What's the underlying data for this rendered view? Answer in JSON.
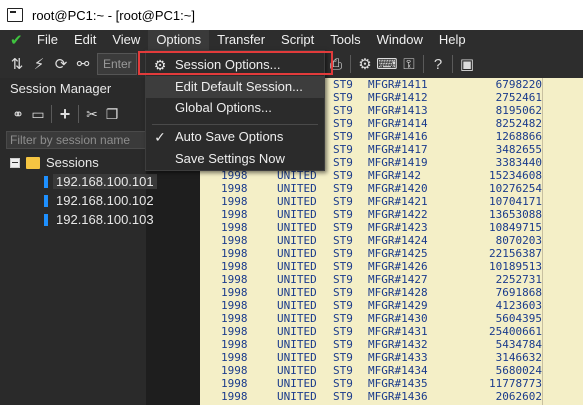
{
  "window": {
    "title": "root@PC1:~ - [root@PC1:~]"
  },
  "menubar": {
    "items": [
      "File",
      "Edit",
      "View",
      "Options",
      "Transfer",
      "Script",
      "Tools",
      "Window",
      "Help"
    ]
  },
  "toolbar": {
    "input_placeholder": "Enter"
  },
  "session_manager": {
    "title": "Session Manager",
    "filter_placeholder": "Filter by session name",
    "root": "Sessions",
    "hosts": [
      "192.168.100.101",
      "192.168.100.102",
      "192.168.100.103"
    ]
  },
  "options_menu": {
    "items": [
      {
        "label": "Session Options...",
        "icon": "gear-icon"
      },
      {
        "label": "Edit Default Session...",
        "icon": ""
      },
      {
        "label": "Global Options...",
        "icon": ""
      },
      {
        "label": "Auto Save Options",
        "icon": "checkmark-icon"
      },
      {
        "label": "Save Settings Now",
        "icon": ""
      }
    ]
  },
  "terminal": {
    "rows": [
      [
        "",
        "",
        "ST9",
        "MFGR#1411",
        "6798220"
      ],
      [
        "",
        "",
        "ST9",
        "MFGR#1412",
        "2752461"
      ],
      [
        "",
        "",
        "ST9",
        "MFGR#1413",
        "8195062"
      ],
      [
        "",
        "",
        "ST9",
        "MFGR#1414",
        "8252482"
      ],
      [
        "",
        "",
        "ST9",
        "MFGR#1416",
        "1268866"
      ],
      [
        "",
        "",
        "ST9",
        "MFGR#1417",
        "3482655"
      ],
      [
        "",
        "",
        "ST9",
        "MFGR#1419",
        "3383440"
      ],
      [
        "1998",
        "UNITED",
        "ST9",
        "MFGR#142",
        "15234608"
      ],
      [
        "1998",
        "UNITED",
        "ST9",
        "MFGR#1420",
        "10276254"
      ],
      [
        "1998",
        "UNITED",
        "ST9",
        "MFGR#1421",
        "10704171"
      ],
      [
        "1998",
        "UNITED",
        "ST9",
        "MFGR#1422",
        "13653088"
      ],
      [
        "1998",
        "UNITED",
        "ST9",
        "MFGR#1423",
        "10849715"
      ],
      [
        "1998",
        "UNITED",
        "ST9",
        "MFGR#1424",
        "8070203"
      ],
      [
        "1998",
        "UNITED",
        "ST9",
        "MFGR#1425",
        "22156387"
      ],
      [
        "1998",
        "UNITED",
        "ST9",
        "MFGR#1426",
        "10189513"
      ],
      [
        "1998",
        "UNITED",
        "ST9",
        "MFGR#1427",
        "2252731"
      ],
      [
        "1998",
        "UNITED",
        "ST9",
        "MFGR#1428",
        "7691868"
      ],
      [
        "1998",
        "UNITED",
        "ST9",
        "MFGR#1429",
        "4123603"
      ],
      [
        "1998",
        "UNITED",
        "ST9",
        "MFGR#1430",
        "5604395"
      ],
      [
        "1998",
        "UNITED",
        "ST9",
        "MFGR#1431",
        "25400661"
      ],
      [
        "1998",
        "UNITED",
        "ST9",
        "MFGR#1432",
        "5434784"
      ],
      [
        "1998",
        "UNITED",
        "ST9",
        "MFGR#1433",
        "3146632"
      ],
      [
        "1998",
        "UNITED",
        "ST9",
        "MFGR#1434",
        "5680024"
      ],
      [
        "1998",
        "UNITED",
        "ST9",
        "MFGR#1435",
        "11778773"
      ],
      [
        "1998",
        "UNITED",
        "ST9",
        "MFGR#1436",
        "2062602"
      ]
    ]
  },
  "colors": {
    "highlight_outline": "#e23b3b",
    "terminal_bg": "#f4efc7",
    "terminal_text": "#1a3b8c",
    "connected_check": "#3fc33f"
  }
}
